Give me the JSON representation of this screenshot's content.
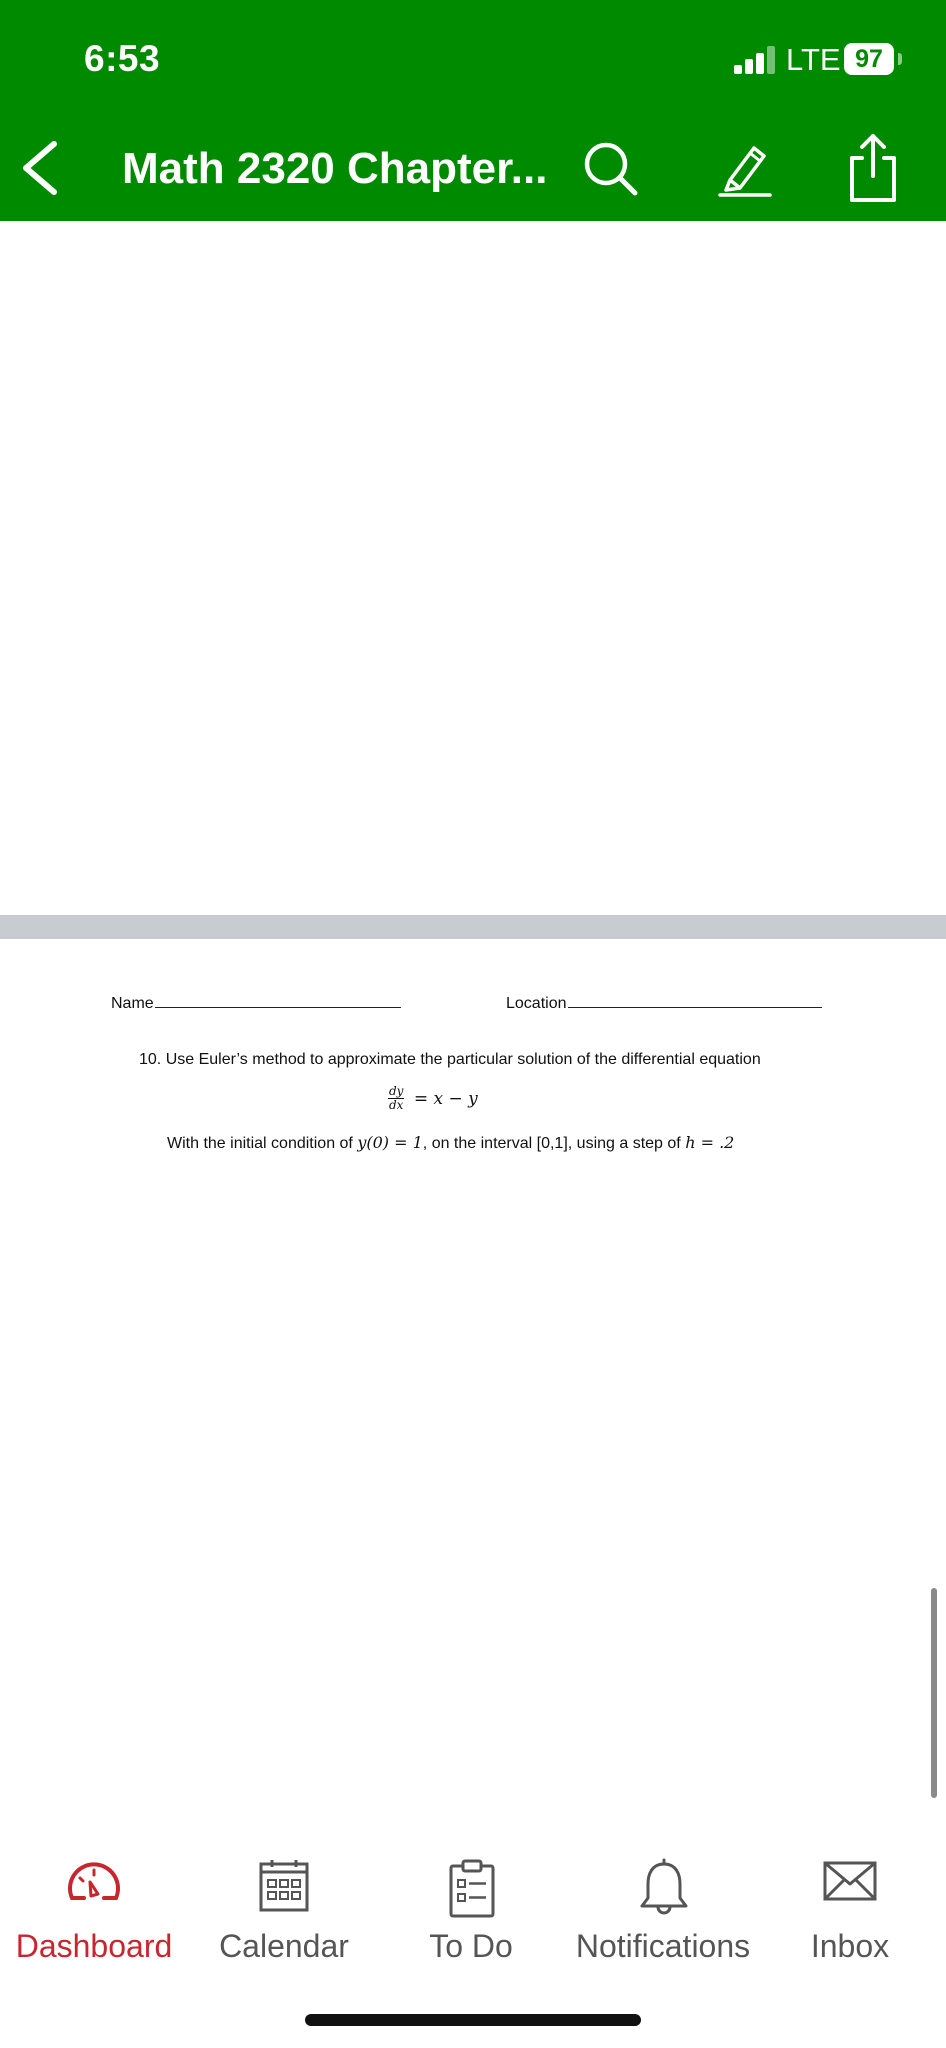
{
  "status_bar": {
    "time": "6:53",
    "network": "LTE",
    "battery": "97"
  },
  "nav": {
    "title": "Math 2320 Chapter...",
    "back_icon": "chevron-left-icon",
    "search_icon": "search-icon",
    "edit_icon": "pen-icon",
    "share_icon": "share-icon"
  },
  "document": {
    "name_label": "Name",
    "location_label": "Location",
    "question": "10. Use Euler’s method to approximate the particular solution of the differential equation",
    "equation": {
      "numerator": "dy",
      "denominator": "dx",
      "rhs": "= x − y"
    },
    "condition": {
      "prefix": "With the initial condition of ",
      "initial": "y(0) = 1",
      "interval_text": ", on the interval [0,1], using a step of ",
      "step": "h = .2"
    }
  },
  "tabs": [
    {
      "label": "Dashboard",
      "icon": "dashboard-gauge-icon",
      "active": true
    },
    {
      "label": "Calendar",
      "icon": "calendar-icon",
      "active": false
    },
    {
      "label": "To Do",
      "icon": "todo-clipboard-icon",
      "active": false
    },
    {
      "label": "Notifications",
      "icon": "bell-icon",
      "active": false
    },
    {
      "label": "Inbox",
      "icon": "envelope-icon",
      "active": false
    }
  ],
  "colors": {
    "header_green": "#008a00",
    "active_tab_red": "#c7262e",
    "inactive_tab_gray": "#555555",
    "page_divider_gray": "#c8ccd1"
  }
}
